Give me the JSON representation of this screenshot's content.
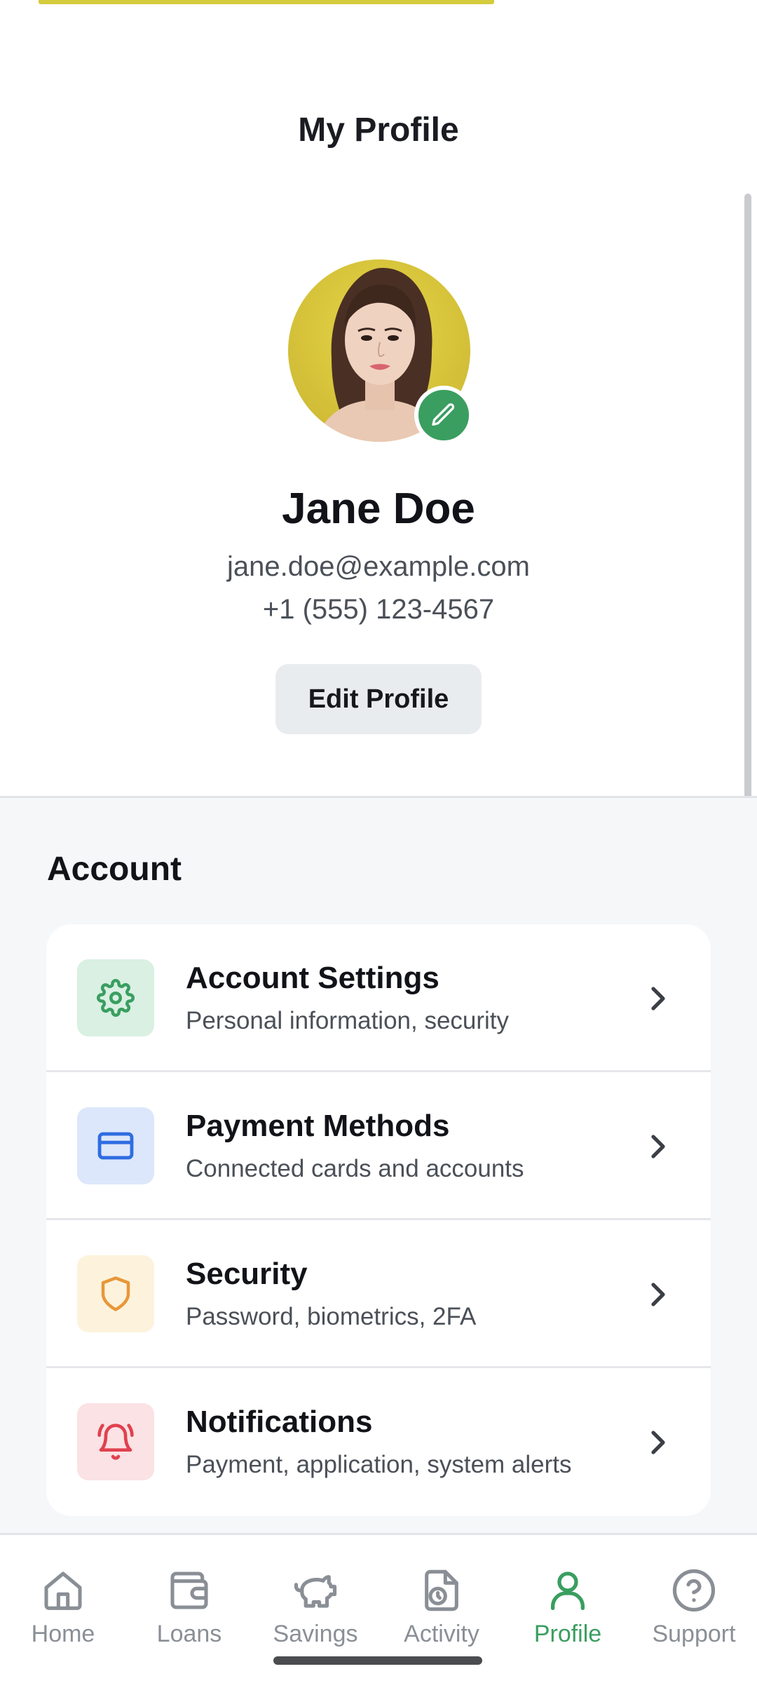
{
  "header": {
    "title": "My Profile"
  },
  "profile": {
    "name": "Jane Doe",
    "email": "jane.doe@example.com",
    "phone": "+1 (555) 123-4567",
    "edit_button": "Edit Profile"
  },
  "account": {
    "section_title": "Account",
    "items": [
      {
        "title": "Account Settings",
        "subtitle": "Personal information, security",
        "icon": "gear-icon",
        "icon_color": "#3a9e60",
        "icon_bg": "#d9f0e3"
      },
      {
        "title": "Payment Methods",
        "subtitle": "Connected cards and accounts",
        "icon": "credit-card-icon",
        "icon_color": "#2f6de1",
        "icon_bg": "#dde7fb"
      },
      {
        "title": "Security",
        "subtitle": "Password, biometrics, 2FA",
        "icon": "shield-icon",
        "icon_color": "#e8973a",
        "icon_bg": "#fdf3dc"
      },
      {
        "title": "Notifications",
        "subtitle": "Payment, application, system alerts",
        "icon": "bell-icon",
        "icon_color": "#e0414f",
        "icon_bg": "#fbe2e4"
      }
    ]
  },
  "nav": {
    "items": [
      {
        "label": "Home",
        "icon": "home-icon"
      },
      {
        "label": "Loans",
        "icon": "wallet-icon"
      },
      {
        "label": "Savings",
        "icon": "piggy-bank-icon"
      },
      {
        "label": "Activity",
        "icon": "activity-icon"
      },
      {
        "label": "Profile",
        "icon": "user-icon",
        "active": true
      },
      {
        "label": "Support",
        "icon": "help-icon"
      }
    ],
    "active_color": "#3a9e60",
    "inactive_color": "#8a8f96"
  }
}
